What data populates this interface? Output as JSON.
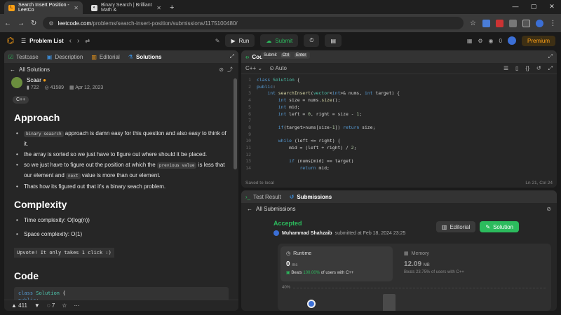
{
  "browser": {
    "tabs": [
      {
        "title": "Search Insert Position - LeetCo",
        "active": true
      },
      {
        "title": "Binary Search | Brilliant Math &",
        "active": false
      }
    ],
    "url_host": "leetcode.com",
    "url_path": "/problems/search-insert-position/submissions/1175100480/"
  },
  "app": {
    "problem_list": "Problem List",
    "run": "Run",
    "submit": "Submit",
    "coins": "0",
    "premium": "Premium"
  },
  "left": {
    "tabs": [
      "Testcase",
      "Description",
      "Editorial",
      "Solutions"
    ],
    "all_solutions": "All Solutions",
    "author": "Scaar",
    "views": "722",
    "reads": "41589",
    "date": "Apr 12, 2023",
    "lang_tag": "C++",
    "approach_title": "Approach",
    "approach": {
      "b1_code": "binary seaarch",
      "b1_text": " approach is damn easy for this question and also easy to think of it.",
      "b2": "the array is sorted so we just have to figure out where should it be placed.",
      "b3_pre": "so we just have to figure out the position at which the ",
      "b3_code1": "previous value",
      "b3_mid": " is less that our element and ",
      "b3_code2": "next",
      "b3_post": " value is more than our element.",
      "b4": "Thats how its figured out that it's a binary seach problem."
    },
    "complexity_title": "Complexity",
    "time": "Time complexity: O(log(n))",
    "space": "Space complexity: O(1)",
    "upvote": "Upvote! It only takes 1 click :)",
    "code_title": "Code",
    "likes": "411",
    "comments": "7"
  },
  "editor": {
    "tab": "Code",
    "lang": "C++",
    "auto": "Auto",
    "tooltip": {
      "label": "Submit",
      "k1": "Ctrl",
      "k2": "Enter"
    },
    "saved": "Saved to local",
    "cursor": "Ln 21, Col 24"
  },
  "result": {
    "tabs": [
      "Test Result",
      "Submissions"
    ],
    "all_submissions": "All Submissions",
    "status": "Accepted",
    "user": "Muhammad Shahzaib",
    "submitted": "submitted at Feb 18, 2024 23:25",
    "editorial_btn": "Editorial",
    "solution_btn": "Solution",
    "runtime_label": "Runtime",
    "runtime_val": "0",
    "runtime_unit": "ms",
    "runtime_beats_pre": "Beats",
    "runtime_beats_pct": "100.00%",
    "runtime_beats_post": "of users with C++",
    "memory_label": "Memory",
    "memory_val": "12.09",
    "memory_unit": "MB",
    "memory_beats": "Beats 23.75% of users with C++",
    "axis_label": "40%"
  },
  "colors": {
    "green": "#2cbb5d",
    "orange": "#ffa116",
    "bg": "#1a1a1a"
  }
}
